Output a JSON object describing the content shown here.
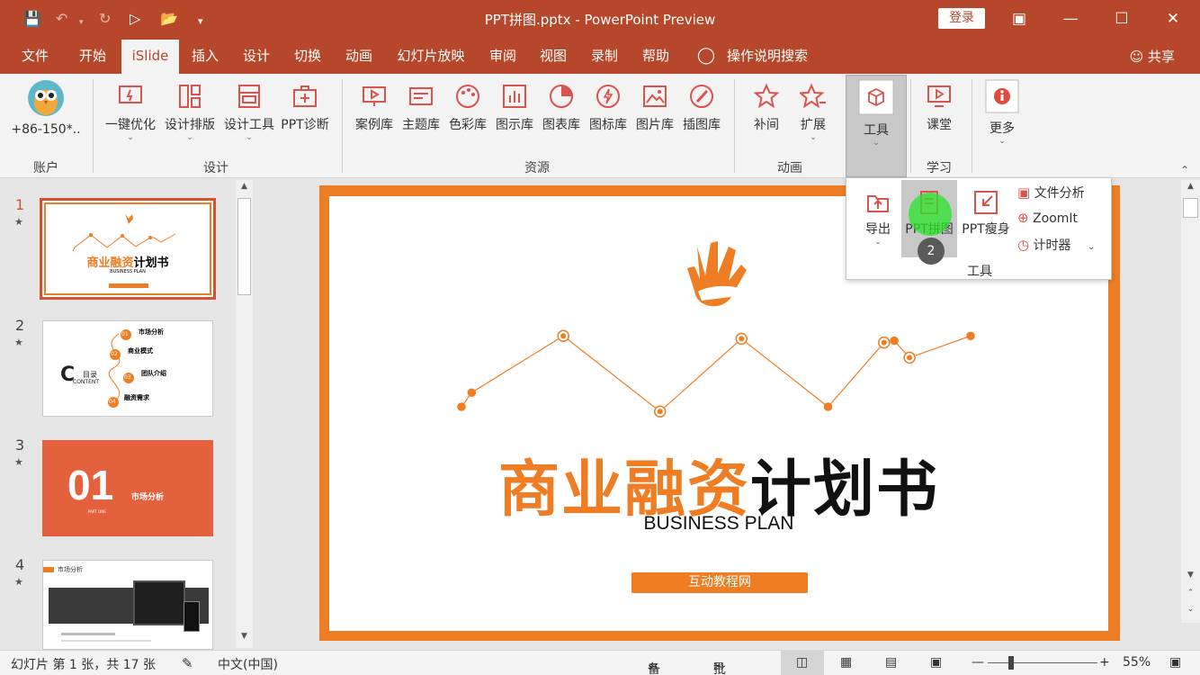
{
  "titlebar": {
    "title": "PPT拼图.pptx  -  PowerPoint Preview",
    "login": "登录"
  },
  "tabs": [
    "文件",
    "开始",
    "iSlide",
    "插入",
    "设计",
    "切换",
    "动画",
    "幻灯片放映",
    "审阅",
    "视图",
    "录制",
    "帮助",
    "操作说明搜索"
  ],
  "share": "共享",
  "ribbon": {
    "account": {
      "label": "+86-150*..",
      "group": "账户"
    },
    "design": {
      "items": [
        "一键优化",
        "设计排版",
        "设计工具",
        "PPT诊断"
      ],
      "group": "设计"
    },
    "resources": {
      "items": [
        "案例库",
        "主题库",
        "色彩库",
        "图示库",
        "图表库",
        "图标库",
        "图片库",
        "插图库"
      ],
      "group": "资源"
    },
    "animation": {
      "items": [
        "补间",
        "扩展"
      ],
      "group": "动画"
    },
    "tools": {
      "label": "工具"
    },
    "learn": {
      "label": "课堂",
      "group": "学习"
    },
    "more": {
      "label": "更多"
    }
  },
  "tools_panel": {
    "items": [
      "导出",
      "PPT拼图",
      "PPT瘦身"
    ],
    "side_items": [
      "文件分析",
      "ZoomIt",
      "计时器"
    ],
    "group": "工具",
    "step_badge": "2"
  },
  "slides": [
    {
      "num": "1",
      "title": "商业融资计划书",
      "subtitle": "BUSINESS PLAN",
      "tag": "互动教程网"
    },
    {
      "num": "2",
      "items": [
        "市场分析",
        "商业模式",
        "团队介绍",
        "融资需求"
      ],
      "nums": [
        "01",
        "02",
        "03",
        "04"
      ],
      "heading": "目录",
      "heading_en": "CONTENT"
    },
    {
      "num": "3",
      "big": "01",
      "label": "市场分析",
      "part": "PART ONE"
    },
    {
      "num": "4",
      "label": "市场分析"
    }
  ],
  "main_slide": {
    "title_orange": "商业融资",
    "title_black": "计划书",
    "subtitle": "BUSINESS PLAN",
    "button": "互动教程网",
    "line_points": [
      [
        0.0,
        0.2
      ],
      [
        0.02,
        0.35
      ],
      [
        0.2,
        0.95
      ],
      [
        0.39,
        0.15
      ],
      [
        0.55,
        0.92
      ],
      [
        0.72,
        0.2
      ],
      [
        0.83,
        0.88
      ],
      [
        0.85,
        0.9
      ],
      [
        0.88,
        0.72
      ],
      [
        1.0,
        0.95
      ]
    ]
  },
  "status": {
    "slide_info": "幻灯片 第 1 张，共 17 张",
    "lang": "中文(中国)",
    "notes": "备注",
    "comments": "批注",
    "zoom": "55%"
  },
  "colors": {
    "brand": "#b7472a",
    "orange": "#ef7d24",
    "accent_red": "#d35230"
  }
}
